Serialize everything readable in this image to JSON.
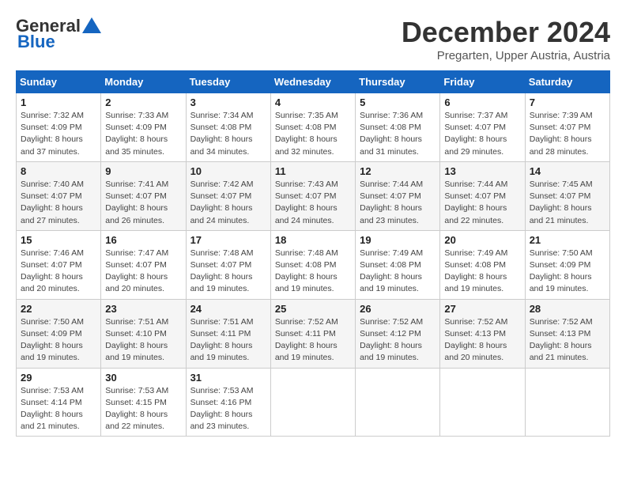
{
  "logo": {
    "general": "General",
    "blue": "Blue"
  },
  "title": "December 2024",
  "subtitle": "Pregarten, Upper Austria, Austria",
  "days_header": [
    "Sunday",
    "Monday",
    "Tuesday",
    "Wednesday",
    "Thursday",
    "Friday",
    "Saturday"
  ],
  "weeks": [
    [
      {
        "day": "1",
        "sunrise": "7:32 AM",
        "sunset": "4:09 PM",
        "daylight": "8 hours and 37 minutes."
      },
      {
        "day": "2",
        "sunrise": "7:33 AM",
        "sunset": "4:09 PM",
        "daylight": "8 hours and 35 minutes."
      },
      {
        "day": "3",
        "sunrise": "7:34 AM",
        "sunset": "4:08 PM",
        "daylight": "8 hours and 34 minutes."
      },
      {
        "day": "4",
        "sunrise": "7:35 AM",
        "sunset": "4:08 PM",
        "daylight": "8 hours and 32 minutes."
      },
      {
        "day": "5",
        "sunrise": "7:36 AM",
        "sunset": "4:08 PM",
        "daylight": "8 hours and 31 minutes."
      },
      {
        "day": "6",
        "sunrise": "7:37 AM",
        "sunset": "4:07 PM",
        "daylight": "8 hours and 29 minutes."
      },
      {
        "day": "7",
        "sunrise": "7:39 AM",
        "sunset": "4:07 PM",
        "daylight": "8 hours and 28 minutes."
      }
    ],
    [
      {
        "day": "8",
        "sunrise": "7:40 AM",
        "sunset": "4:07 PM",
        "daylight": "8 hours and 27 minutes."
      },
      {
        "day": "9",
        "sunrise": "7:41 AM",
        "sunset": "4:07 PM",
        "daylight": "8 hours and 26 minutes."
      },
      {
        "day": "10",
        "sunrise": "7:42 AM",
        "sunset": "4:07 PM",
        "daylight": "8 hours and 24 minutes."
      },
      {
        "day": "11",
        "sunrise": "7:43 AM",
        "sunset": "4:07 PM",
        "daylight": "8 hours and 24 minutes."
      },
      {
        "day": "12",
        "sunrise": "7:44 AM",
        "sunset": "4:07 PM",
        "daylight": "8 hours and 23 minutes."
      },
      {
        "day": "13",
        "sunrise": "7:44 AM",
        "sunset": "4:07 PM",
        "daylight": "8 hours and 22 minutes."
      },
      {
        "day": "14",
        "sunrise": "7:45 AM",
        "sunset": "4:07 PM",
        "daylight": "8 hours and 21 minutes."
      }
    ],
    [
      {
        "day": "15",
        "sunrise": "7:46 AM",
        "sunset": "4:07 PM",
        "daylight": "8 hours and 20 minutes."
      },
      {
        "day": "16",
        "sunrise": "7:47 AM",
        "sunset": "4:07 PM",
        "daylight": "8 hours and 20 minutes."
      },
      {
        "day": "17",
        "sunrise": "7:48 AM",
        "sunset": "4:07 PM",
        "daylight": "8 hours and 19 minutes."
      },
      {
        "day": "18",
        "sunrise": "7:48 AM",
        "sunset": "4:08 PM",
        "daylight": "8 hours and 19 minutes."
      },
      {
        "day": "19",
        "sunrise": "7:49 AM",
        "sunset": "4:08 PM",
        "daylight": "8 hours and 19 minutes."
      },
      {
        "day": "20",
        "sunrise": "7:49 AM",
        "sunset": "4:08 PM",
        "daylight": "8 hours and 19 minutes."
      },
      {
        "day": "21",
        "sunrise": "7:50 AM",
        "sunset": "4:09 PM",
        "daylight": "8 hours and 19 minutes."
      }
    ],
    [
      {
        "day": "22",
        "sunrise": "7:50 AM",
        "sunset": "4:09 PM",
        "daylight": "8 hours and 19 minutes."
      },
      {
        "day": "23",
        "sunrise": "7:51 AM",
        "sunset": "4:10 PM",
        "daylight": "8 hours and 19 minutes."
      },
      {
        "day": "24",
        "sunrise": "7:51 AM",
        "sunset": "4:11 PM",
        "daylight": "8 hours and 19 minutes."
      },
      {
        "day": "25",
        "sunrise": "7:52 AM",
        "sunset": "4:11 PM",
        "daylight": "8 hours and 19 minutes."
      },
      {
        "day": "26",
        "sunrise": "7:52 AM",
        "sunset": "4:12 PM",
        "daylight": "8 hours and 19 minutes."
      },
      {
        "day": "27",
        "sunrise": "7:52 AM",
        "sunset": "4:13 PM",
        "daylight": "8 hours and 20 minutes."
      },
      {
        "day": "28",
        "sunrise": "7:52 AM",
        "sunset": "4:13 PM",
        "daylight": "8 hours and 21 minutes."
      }
    ],
    [
      {
        "day": "29",
        "sunrise": "7:53 AM",
        "sunset": "4:14 PM",
        "daylight": "8 hours and 21 minutes."
      },
      {
        "day": "30",
        "sunrise": "7:53 AM",
        "sunset": "4:15 PM",
        "daylight": "8 hours and 22 minutes."
      },
      {
        "day": "31",
        "sunrise": "7:53 AM",
        "sunset": "4:16 PM",
        "daylight": "8 hours and 23 minutes."
      },
      null,
      null,
      null,
      null
    ]
  ]
}
